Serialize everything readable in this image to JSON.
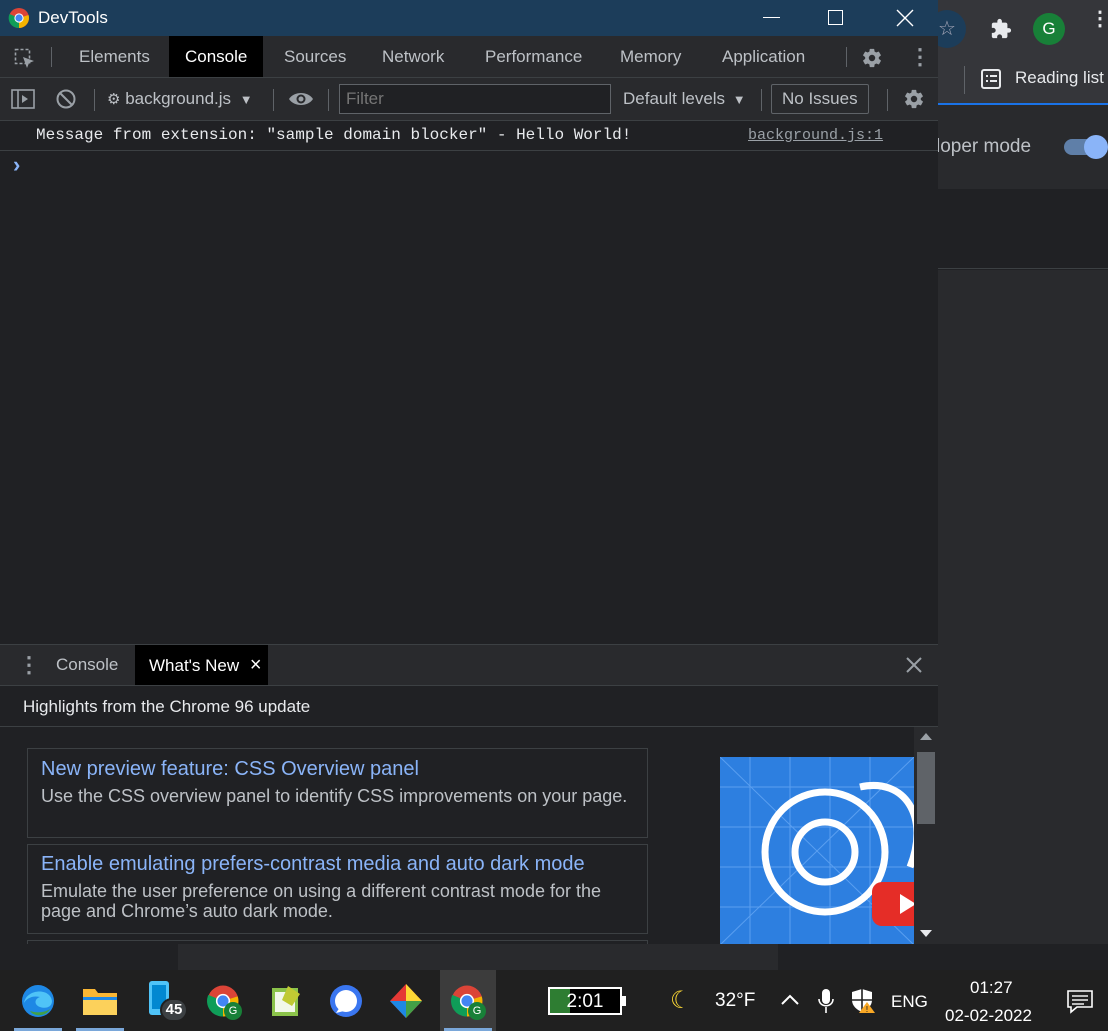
{
  "window": {
    "title": "DevTools"
  },
  "browser_bg": {
    "bookmark_label": "Reading list",
    "dev_mode_label": "loper mode",
    "avatar_letter": "G"
  },
  "devtools": {
    "tabs": [
      "Elements",
      "Console",
      "Sources",
      "Network",
      "Performance",
      "Memory",
      "Application"
    ],
    "active_tab": "Console"
  },
  "console_toolbar": {
    "context": "background.js",
    "filter_placeholder": "Filter",
    "levels": "Default levels",
    "issues": "No Issues"
  },
  "console": {
    "message": "Message from extension: \"sample domain blocker\" - Hello World!",
    "source": "background.js:1",
    "prompt": "›"
  },
  "drawer": {
    "tabs": [
      "Console",
      "What's New"
    ],
    "active_tab": "What's New",
    "tab_close": "×",
    "heading": "Highlights from the Chrome 96 update",
    "items": [
      {
        "title": "New preview feature: CSS Overview panel",
        "desc": "Use the CSS overview panel to identify CSS improvements on your page."
      },
      {
        "title": "Enable emulating prefers-contrast media and auto dark mode",
        "desc": "Emulate the user preference on using a different contrast mode for the page and Chrome’s auto dark mode."
      }
    ]
  },
  "taskbar": {
    "badge_count": "45",
    "battery_text": "2:01",
    "temperature": "32°F",
    "language": "ENG",
    "time": "01:27",
    "date": "02-02-2022",
    "chrome_avatar": "G"
  },
  "colors": {
    "titlebar": "#1c3d5a",
    "link_blue": "#8ab4f8",
    "accent": "#1a73e8",
    "taskbar": "#202020"
  }
}
